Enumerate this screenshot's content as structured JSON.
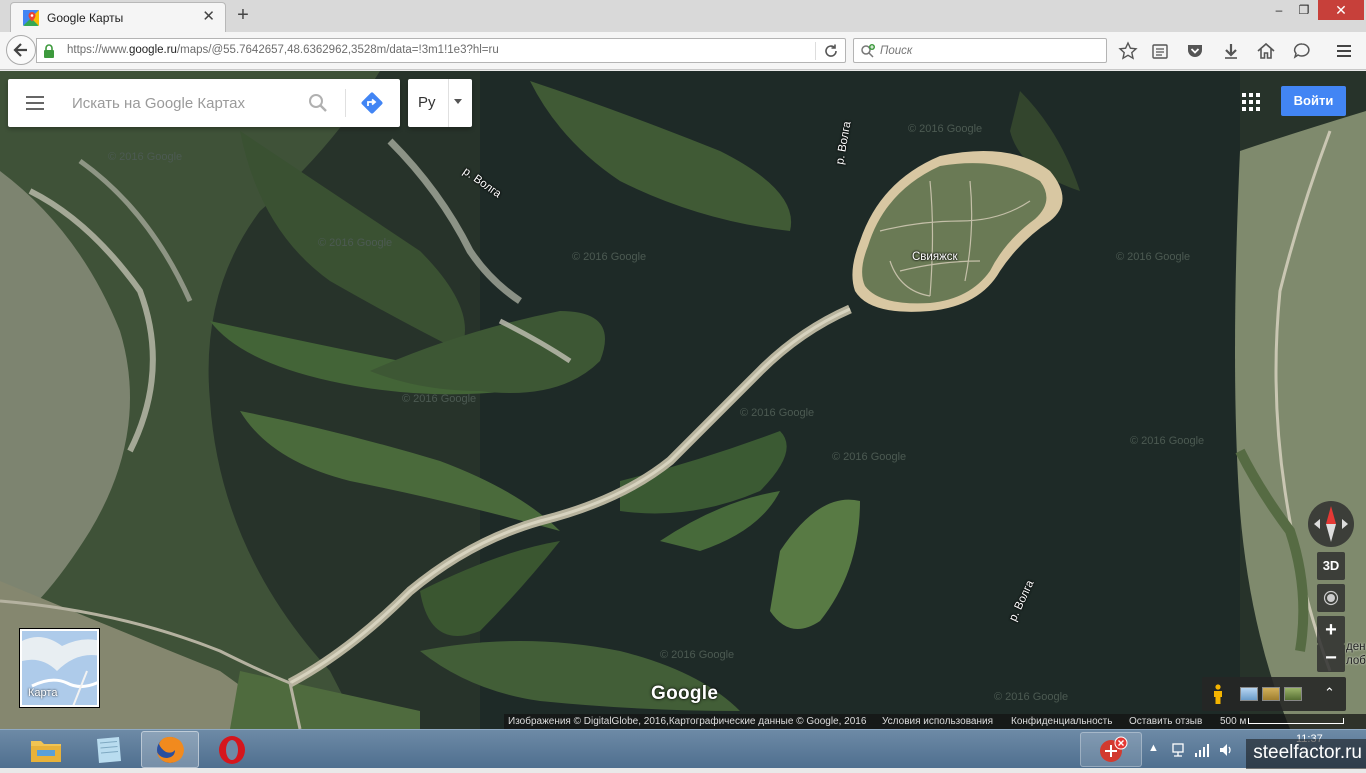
{
  "browser": {
    "tab_title": "Google Карты",
    "tab_close": "✕",
    "new_tab": "+",
    "url_prefix": "https://www.",
    "url_domain": "google.ru",
    "url_path": "/maps/@55.7642657,48.6362962,3528m/data=!3m1!1e3?hl=ru",
    "search_placeholder": "Поиск",
    "window_buttons": {
      "minimize": "‒",
      "maximize": "❐",
      "close": "✕"
    }
  },
  "maps": {
    "search_placeholder": "Искать на Google Картах",
    "language": "Ру",
    "signin_label": "Войти",
    "place_labels": {
      "sviyazhsk": "Свияжск",
      "volga_1": "р. Волга",
      "volga_2": "р. Волга",
      "volga_3": "р. Волга",
      "edge_1": "ден",
      "edge_2": "лоб"
    },
    "watermarks": [
      "© 2016 Google",
      "© 2016 Google",
      "© 2016 Google",
      "© 2016 Google",
      "© 2016 Google",
      "© 2016 Google",
      "© 2016 Google",
      "© 2016 Google",
      "© 2016 Google",
      "© 2016 Google",
      "© 2016 Google"
    ],
    "controls": {
      "btn_3d": "3D",
      "zoom_in": "+",
      "zoom_out": "−",
      "expand": "⌃"
    },
    "minimap_label": "Карта",
    "logo": "Google",
    "footer": {
      "attribution": "Изображения © DigitalGlobe, 2016,Картографические данные © Google, 2016",
      "terms": "Условия использования",
      "privacy": "Конфиденциальность",
      "feedback": "Оставить отзыв",
      "scale": "500 м"
    }
  },
  "taskbar": {
    "apps": [
      "explorer",
      "notes",
      "firefox",
      "opera"
    ],
    "clock": "11:37",
    "tray_arrow": "▲"
  },
  "watermark": "steelfactor.ru",
  "colors": {
    "signin_blue": "#4285f4",
    "directions_blue": "#4285f4",
    "window_close_red": "#c7403a"
  }
}
